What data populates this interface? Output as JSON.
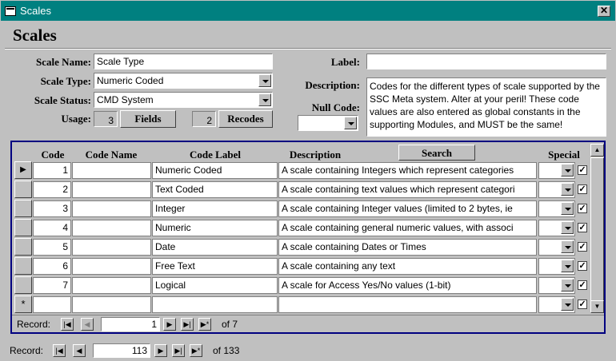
{
  "window": {
    "title": "Scales",
    "close_glyph": "✕"
  },
  "heading": "Scales",
  "form": {
    "scale_name_label": "Scale Name:",
    "scale_name_value": "Scale Type",
    "scale_type_label": "Scale Type:",
    "scale_type_value": "Numeric Coded",
    "scale_status_label": "Scale Status:",
    "scale_status_value": "CMD System",
    "usage_label": "Usage:",
    "usage_fields_count": "3",
    "fields_button": "Fields",
    "usage_recodes_count": "2",
    "recodes_button": "Recodes",
    "label_label": "Label:",
    "label_value": "",
    "description_label": "Description:",
    "description_value": "Codes for the different types of scale supported by the SSC Meta system. Alter at your peril! These code values are also entered as global constants in the supporting Modules, and MUST be the same!",
    "null_code_label": "Null Code:",
    "null_code_value": ""
  },
  "subform": {
    "headers": {
      "code": "Code",
      "code_name": "Code Name",
      "code_label": "Code Label",
      "description": "Description",
      "search": "Search",
      "special": "Special"
    },
    "rows": [
      {
        "code": "1",
        "code_name": "",
        "code_label": "Numeric Coded",
        "description": "A scale containing Integers which represent categories",
        "checked": true
      },
      {
        "code": "2",
        "code_name": "",
        "code_label": "Text Coded",
        "description": "A scale containing text values which represent categori",
        "checked": true
      },
      {
        "code": "3",
        "code_name": "",
        "code_label": "Integer",
        "description": "A scale containing Integer values (limited to 2 bytes, ie",
        "checked": true
      },
      {
        "code": "4",
        "code_name": "",
        "code_label": "Numeric",
        "description": "A scale containing general numeric values, with associ",
        "checked": true
      },
      {
        "code": "5",
        "code_name": "",
        "code_label": "Date",
        "description": "A scale containing Dates or Times",
        "checked": true
      },
      {
        "code": "6",
        "code_name": "",
        "code_label": "Free Text",
        "description": "A scale containing any text",
        "checked": true
      },
      {
        "code": "7",
        "code_name": "",
        "code_label": "Logical",
        "description": "A scale for Access Yes/No values (1-bit)",
        "checked": true
      }
    ],
    "new_row_glyph": "*",
    "current_row_glyph": "▶",
    "nav": {
      "label": "Record:",
      "current": "1",
      "of_text": "of 7"
    }
  },
  "main_nav": {
    "label": "Record:",
    "current": "113",
    "of_text": "of 133"
  }
}
